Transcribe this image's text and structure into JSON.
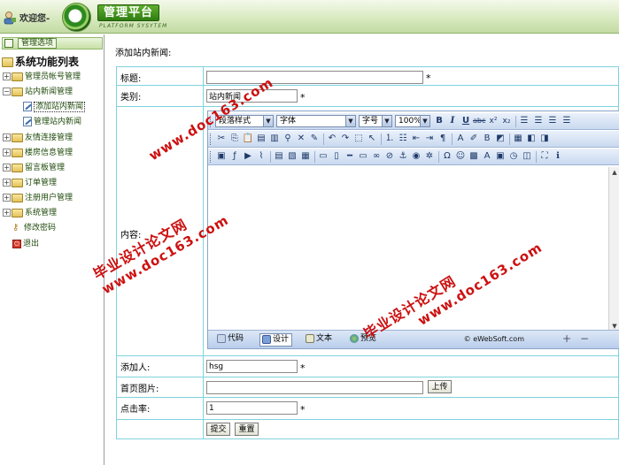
{
  "header": {
    "welcome": "欢迎您-",
    "title": "管理平台",
    "subtitle": "PLATFORM SYSYTEM"
  },
  "sidebar": {
    "panel_label": "管理选项",
    "root": "系统功能列表",
    "items": [
      {
        "label": "管理员帐号管理",
        "type": "folder"
      },
      {
        "label": "站内新闻管理",
        "type": "folder-open"
      },
      {
        "label": "添加站内新闻",
        "type": "page",
        "selected": true
      },
      {
        "label": "管理站内新闻",
        "type": "page"
      },
      {
        "label": "友情连接管理",
        "type": "folder"
      },
      {
        "label": "楼房信息管理",
        "type": "folder"
      },
      {
        "label": "留言板管理",
        "type": "folder"
      },
      {
        "label": "订单管理",
        "type": "folder"
      },
      {
        "label": "注册用户管理",
        "type": "folder"
      },
      {
        "label": "系统管理",
        "type": "folder"
      },
      {
        "label": "修改密码",
        "type": "key"
      },
      {
        "label": "退出",
        "type": "exit"
      }
    ]
  },
  "main": {
    "page_title": "添加站内新闻:",
    "fields": {
      "title": {
        "label": "标题:",
        "value": "",
        "required": "*"
      },
      "category": {
        "label": "类别:",
        "value": "站内新闻",
        "required": "*"
      },
      "content": {
        "label": "内容:"
      },
      "author": {
        "label": "添加人:",
        "value": "hsg",
        "required": "*"
      },
      "image": {
        "label": "首页图片:",
        "value": "",
        "upload_label": "上传"
      },
      "clicks": {
        "label": "点击率:",
        "value": "1",
        "required": "*"
      }
    },
    "submit_label": "提交",
    "reset_label": "重置"
  },
  "editor": {
    "paragraph_style": "段落样式",
    "font": "字体",
    "font_size": "字号",
    "zoom": "100%",
    "modes": [
      "代码",
      "设计",
      "文本",
      "预览"
    ],
    "active_mode": "设计",
    "copyright": "© eWebSoft.com"
  },
  "watermarks": [
    {
      "line1": "毕业设计论文网",
      "line2": "www.doc163.com"
    },
    {
      "line1": "毕业设计论文网",
      "line2": "www.doc163.com"
    },
    {
      "line1": "毕业设计论文网",
      "line2": "www.doc163.com"
    }
  ]
}
